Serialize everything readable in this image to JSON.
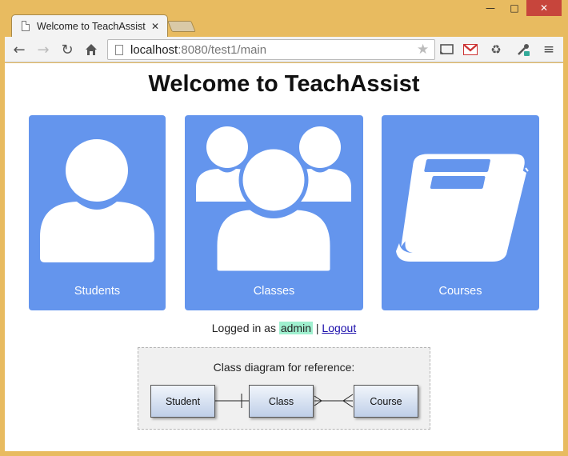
{
  "browser": {
    "tab_title": "Welcome to TeachAssist",
    "url_host": "localhost",
    "url_rest": ":8080/test1/main"
  },
  "page": {
    "heading": "Welcome to TeachAssist",
    "tiles": [
      {
        "label": "Students",
        "icon": "person-icon"
      },
      {
        "label": "Classes",
        "icon": "group-icon"
      },
      {
        "label": "Courses",
        "icon": "book-icon"
      }
    ],
    "login": {
      "prefix": "Logged in as",
      "user": "admin",
      "separator": "|",
      "logout": "Logout"
    },
    "diagram": {
      "caption": "Class diagram for reference:",
      "boxes": [
        "Student",
        "Class",
        "Course"
      ]
    }
  },
  "colors": {
    "tile": "#6495ed",
    "user_highlight": "#9ff0cf",
    "frame": "#e8bb60"
  }
}
